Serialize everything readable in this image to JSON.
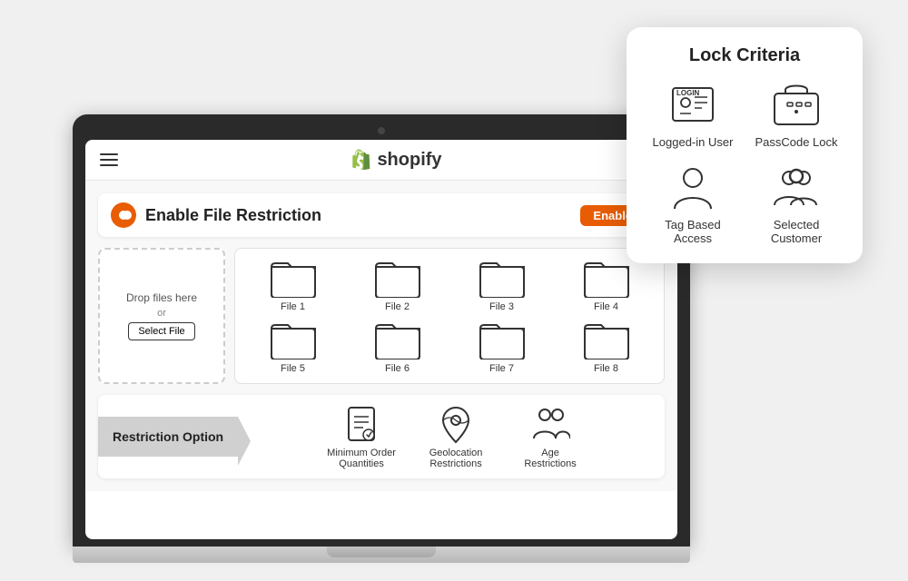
{
  "shopify": {
    "brand": "shopify",
    "logo_alt": "Shopify logo"
  },
  "header": {
    "title": "Enable File Restriction",
    "status": "Enabled"
  },
  "dropzone": {
    "drop_text": "Drop files here",
    "or_text": "or",
    "select_btn": "Select File"
  },
  "files": [
    {
      "label": "File 1"
    },
    {
      "label": "File 2"
    },
    {
      "label": "File 3"
    },
    {
      "label": "File 4"
    },
    {
      "label": "File 5"
    },
    {
      "label": "File 6"
    },
    {
      "label": "File 7"
    },
    {
      "label": "File 8"
    }
  ],
  "restriction": {
    "section_label": "Restriction Option",
    "options": [
      {
        "label": "Minimum Order Quantities"
      },
      {
        "label": "Geolocation Restrictions"
      },
      {
        "label": "Age Restrictions"
      }
    ]
  },
  "lock_criteria": {
    "title": "Lock Criteria",
    "items": [
      {
        "label": "Logged-in User"
      },
      {
        "label": "PassCode Lock"
      },
      {
        "label": "Tag Based Access"
      },
      {
        "label": "Selected Customer"
      }
    ]
  }
}
